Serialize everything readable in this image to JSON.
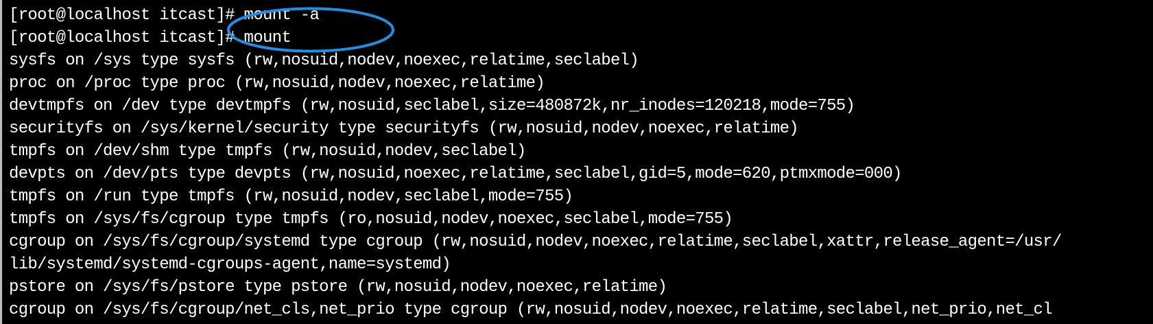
{
  "terminal": {
    "lines": [
      "[root@localhost itcast]# mount -a",
      "[root@localhost itcast]# mount",
      "sysfs on /sys type sysfs (rw,nosuid,nodev,noexec,relatime,seclabel)",
      "proc on /proc type proc (rw,nosuid,nodev,noexec,relatime)",
      "devtmpfs on /dev type devtmpfs (rw,nosuid,seclabel,size=480872k,nr_inodes=120218,mode=755)",
      "securityfs on /sys/kernel/security type securityfs (rw,nosuid,nodev,noexec,relatime)",
      "tmpfs on /dev/shm type tmpfs (rw,nosuid,nodev,seclabel)",
      "devpts on /dev/pts type devpts (rw,nosuid,noexec,relatime,seclabel,gid=5,mode=620,ptmxmode=000)",
      "tmpfs on /run type tmpfs (rw,nosuid,nodev,seclabel,mode=755)",
      "tmpfs on /sys/fs/cgroup type tmpfs (ro,nosuid,nodev,noexec,seclabel,mode=755)",
      "cgroup on /sys/fs/cgroup/systemd type cgroup (rw,nosuid,nodev,noexec,relatime,seclabel,xattr,release_agent=/usr/",
      "lib/systemd/systemd-cgroups-agent,name=systemd)",
      "pstore on /sys/fs/pstore type pstore (rw,nosuid,nodev,noexec,relatime)",
      "cgroup on /sys/fs/cgroup/net_cls,net_prio type cgroup (rw,nosuid,nodev,noexec,relatime,seclabel,net_prio,net_cl"
    ]
  },
  "colors": {
    "background": "#000000",
    "text": "#ffffff",
    "annotation": "#1e8fe6"
  }
}
